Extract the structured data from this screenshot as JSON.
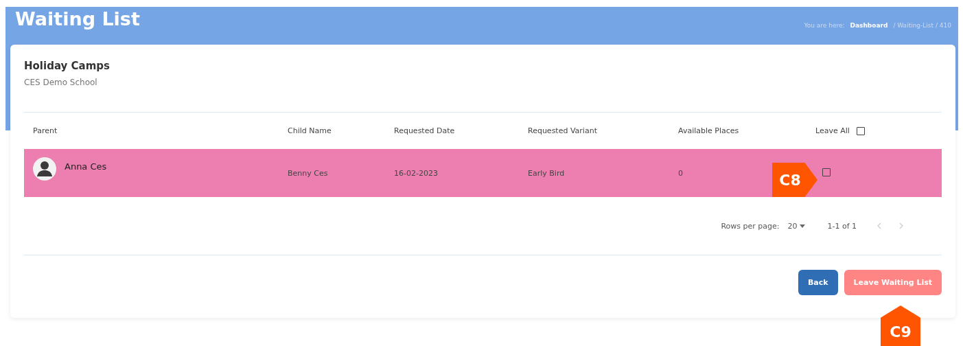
{
  "header": {
    "title": "Waiting List",
    "breadcrumb": {
      "prefix": "You are here:",
      "link": "Dashboard",
      "trail": "/ Waiting-List /  410"
    }
  },
  "card": {
    "title": "Holiday Camps",
    "subtitle": "CES Demo School"
  },
  "table": {
    "columns": [
      "Parent",
      "Child Name",
      "Requested Date",
      "Requested Variant",
      "Available Places"
    ],
    "leave_all": {
      "label": "Leave All",
      "checked": false
    },
    "rows": [
      {
        "parent": "Anna Ces",
        "child": "Benny Ces",
        "date": "16-02-2023",
        "variant": "Early Bird",
        "places": "0",
        "checked": false,
        "highlighted": true
      }
    ]
  },
  "pagination": {
    "label": "Rows per page:",
    "rows_per_page": "20",
    "range": "1-1 of 1"
  },
  "buttons": [
    {
      "label": "Back",
      "kind": "secondary"
    },
    {
      "label": "Leave Waiting List",
      "kind": "danger"
    }
  ],
  "callouts": [
    {
      "label": "C8",
      "kind": "right"
    },
    {
      "label": "C9",
      "kind": "up"
    }
  ]
}
